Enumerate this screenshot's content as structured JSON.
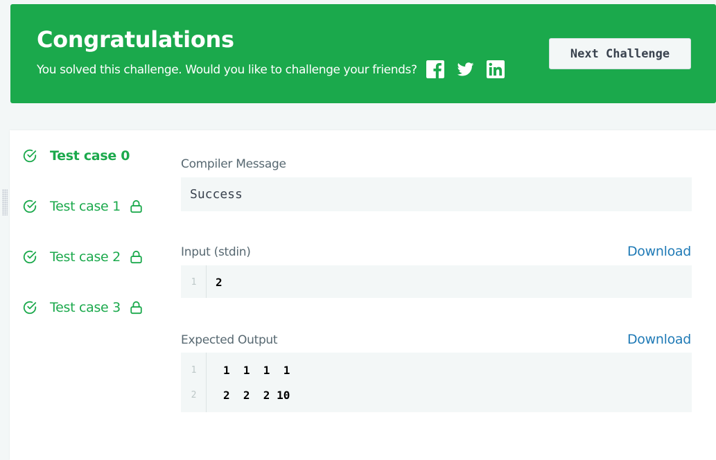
{
  "banner": {
    "title": "Congratulations",
    "subtitle": "You solved this challenge. Would you like to challenge your friends?",
    "social_icons": [
      "facebook-icon",
      "twitter-icon",
      "linkedin-icon"
    ],
    "next_button_label": "Next Challenge",
    "background_color": "#1ba94c"
  },
  "test_cases": [
    {
      "label": "Test case 0",
      "status": "passed",
      "active": true,
      "locked": false
    },
    {
      "label": "Test case 1",
      "status": "passed",
      "active": false,
      "locked": true
    },
    {
      "label": "Test case 2",
      "status": "passed",
      "active": false,
      "locked": true
    },
    {
      "label": "Test case 3",
      "status": "passed",
      "active": false,
      "locked": true
    }
  ],
  "compiler": {
    "label": "Compiler Message",
    "message": "Success"
  },
  "input": {
    "label": "Input (stdin)",
    "download_label": "Download",
    "lines": [
      {
        "n": "1",
        "text": "2"
      }
    ]
  },
  "expected_output": {
    "label": "Expected Output",
    "download_label": "Download",
    "lines": [
      {
        "n": "1",
        "text": "1  1  1  1"
      },
      {
        "n": "2",
        "text": "2  2  2 10"
      }
    ]
  },
  "colors": {
    "accent_green": "#1ba94c",
    "link_blue": "#1f7ab6",
    "label_gray": "#576871"
  }
}
